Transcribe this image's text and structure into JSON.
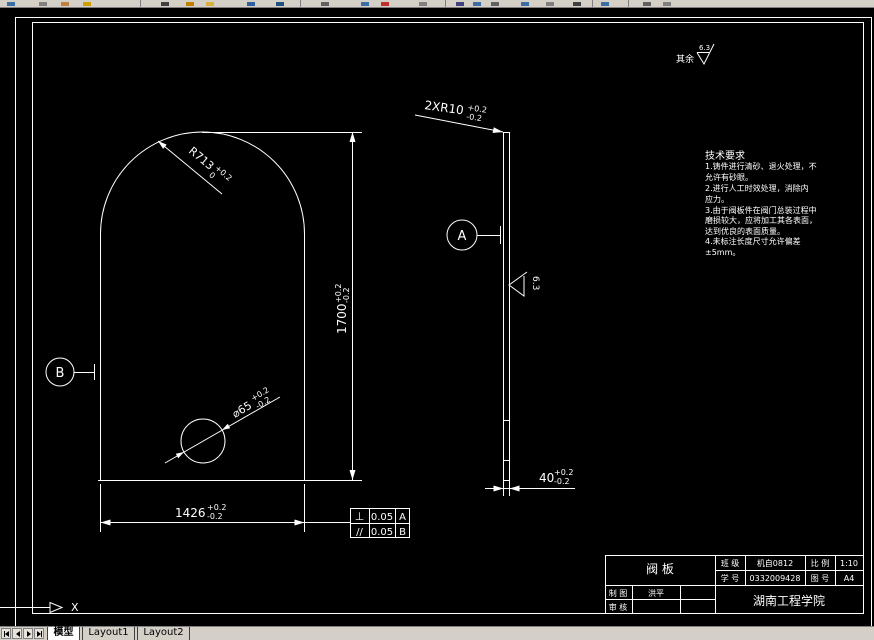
{
  "app": {
    "background": "#000000",
    "line_color": "#ffffff",
    "chrome_color": "#d4d0c8"
  },
  "drawing": {
    "roughness_note": {
      "label": "其余",
      "value": "6.3"
    },
    "tech_requirements": {
      "title": "技术要求",
      "lines": [
        "1.铸件进行清砂、退火处理，不",
        "允许有砂眼。",
        "2.进行人工时效处理，消除内",
        "应力。",
        "3.由于阀板件在阀门总装过程中",
        "磨损较大，应将加工其各表面，",
        "达到优良的表面质量。",
        "4.未标注长度尺寸允许偏差",
        "±5mm。"
      ]
    },
    "dimensions": {
      "height": {
        "value": "1700",
        "upper": "+0.2",
        "lower": "-0.2"
      },
      "width": {
        "value": "1426",
        "upper": "+0.2",
        "lower": "-0.2"
      },
      "radius": {
        "value": "R713",
        "upper": "+0.2",
        "lower": "0"
      },
      "hole": {
        "value": "⌀65",
        "upper": "+0.2",
        "lower": "-0.2"
      },
      "corner": {
        "value": "2XR10",
        "upper": "+0.2",
        "lower": "-0.2"
      },
      "thickness": {
        "value": "40",
        "upper": "+0.2",
        "lower": "-0.2"
      }
    },
    "section_markers": {
      "a": "A",
      "b": "B"
    },
    "side_roughness": "6.3",
    "tolerances": [
      {
        "symbol": "⊥",
        "value": "0.05",
        "datum": "A"
      },
      {
        "symbol": "//",
        "value": "0.05",
        "datum": "B"
      }
    ],
    "ucs": {
      "x_label": "X"
    }
  },
  "title_block": {
    "part_name": "阀 板",
    "class_label": "班 级",
    "class_value": "机自0812",
    "scale_label": "比 例",
    "scale_value": "1:10",
    "student_id_label": "学 号",
    "student_id_value": "0332009428",
    "drawing_no_label": "图 号",
    "drawing_no_value": "A4",
    "drawn_by_label": "制 图",
    "drawn_by_value": "洪平",
    "checked_by_label": "审 核",
    "school": "湖南工程学院"
  },
  "tabs": [
    {
      "label": "模型",
      "active": true
    },
    {
      "label": "Layout1",
      "active": false
    },
    {
      "label": "Layout2",
      "active": false
    }
  ]
}
